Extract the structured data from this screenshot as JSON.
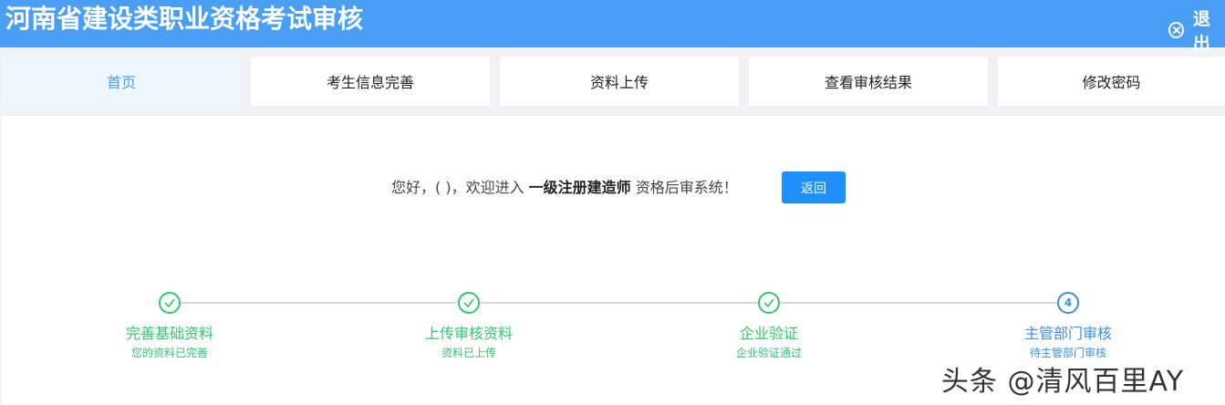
{
  "header": {
    "title": "河南省建设类职业资格考试审核",
    "logout_label": "退出"
  },
  "nav": {
    "tabs": [
      {
        "label": "首页",
        "active": true
      },
      {
        "label": "考生信息完善",
        "active": false
      },
      {
        "label": "资料上传",
        "active": false
      },
      {
        "label": "查看审核结果",
        "active": false
      },
      {
        "label": "修改密码",
        "active": false
      }
    ]
  },
  "main": {
    "greeting_prefix": "您好，(  )，欢迎进入 ",
    "greeting_bold": "一级注册建造师",
    "greeting_suffix": " 资格后审系统！",
    "back_button_label": "返回"
  },
  "steps": [
    {
      "title": "完善基础资料",
      "desc": "您的资料已完善",
      "status": "done"
    },
    {
      "title": "上传审核资料",
      "desc": "资料已上传",
      "status": "done"
    },
    {
      "title": "企业验证",
      "desc": "企业验证通过",
      "status": "done"
    },
    {
      "title": "主管部门审核",
      "desc": "待主管部门审核",
      "status": "current",
      "number": "4"
    }
  ],
  "watermark": "头条 @清风百里AY",
  "colors": {
    "header_bg": "#4a9ff5",
    "step_done": "#2ec96b",
    "step_current": "#3a8ef0",
    "button_bg": "#1e8fff"
  }
}
